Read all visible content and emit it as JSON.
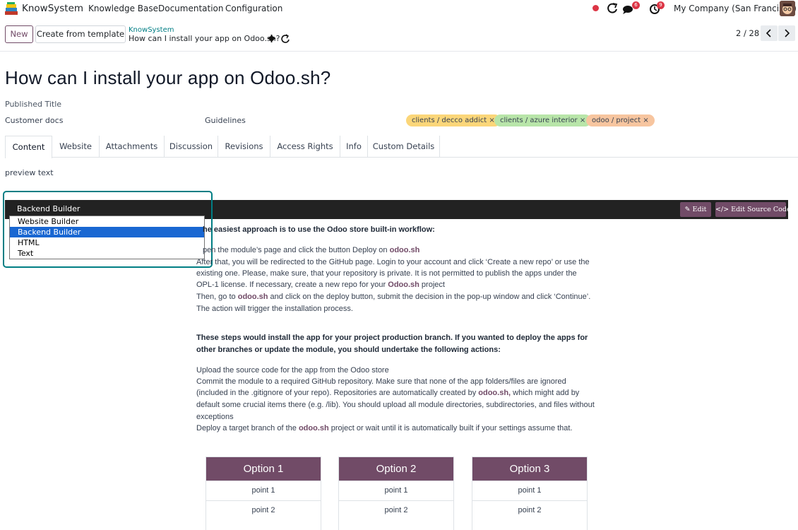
{
  "nav": {
    "app_name": "KnowSystem",
    "menu": [
      "Knowledge Base",
      "Documentation",
      "Configuration"
    ],
    "messages_count": "6",
    "activities_count": "9",
    "company": "My Company (San Francisco)"
  },
  "control": {
    "new_label": "New",
    "template_label": "Create from template",
    "breadcrumb_parent": "KnowSystem",
    "breadcrumb_current": "How can I install your app on Odoo.sh?",
    "pager": "2 / 28"
  },
  "form": {
    "title": "How can I install your app on Odoo.sh?",
    "published_title_label": "Published Title",
    "section": "Customer docs",
    "type": "Guidelines",
    "tags": [
      {
        "label": "clients / decco addict ×",
        "color": "#fbd679"
      },
      {
        "label": "clients / azure interior ×",
        "color": "#b8e5a9"
      },
      {
        "label": "odoo / project ×",
        "color": "#f7c59f"
      }
    ]
  },
  "tabs": [
    "Content",
    "Website",
    "Attachments",
    "Discussion",
    "Revisions",
    "Access Rights",
    "Info",
    "Custom Details"
  ],
  "editor": {
    "preview_label": "preview text",
    "edit_label": "Edit",
    "edit_source_label": "Edit Source Code",
    "builder_selected": "Backend Builder",
    "builder_options": [
      "Website Builder",
      "Backend Builder",
      "HTML",
      "Text"
    ]
  },
  "article": {
    "intro": "he easiest approach is to use the Odoo store built-in workflow:",
    "line1_pre": "pen the module’s page and click the button Deploy on ",
    "line1_link": "odoo.sh",
    "line2": "After that, you will be redirected to the GitHub page. Login to your account and click ‘Create a new repo’ or use the",
    "line3": "existing one. Please, make sure, that your repository is private. It is not permitted to publish the apps under the",
    "line4_pre": "OPL-1 license. If necessary, create a new repo for your ",
    "line4_link": "Odoo.sh",
    "line4_post": " project",
    "line5_pre": "Then, go to ",
    "line5_link": "odoo.sh",
    "line5_post": " and click on the deploy button, submit the decision in the pop-up window and click ‘Continue’.",
    "line6": "The action will trigger the installation process.",
    "heading2_line1": "These steps would install the app for your project production branch. If you wanted to deploy the apps for",
    "heading2_line2": "other branches or update the module, you should undertake the following actions:",
    "p1": "Upload the source code for the app from the Odoo store",
    "p2": "Commit the module to a required GitHub repository. Make sure that none of the app folders/files are ignored",
    "p3_pre": "(included in the .gitignore of your repo). Repositories are automatically created by ",
    "p3_link": "odoo.sh,",
    "p3_post": " which might add by",
    "p4": "default some crucial items there (e.g. /lib). You should upload all module directories, subdirectories, and files without",
    "p5": "exceptions",
    "p6_pre": "Deploy a target branch of the ",
    "p6_link": "odoo.sh",
    "p6_post": " project or wait until it is automatically built if your settings assume that.",
    "options": [
      {
        "title": "Option 1",
        "points": [
          "point 1",
          "point 2"
        ]
      },
      {
        "title": "Option 2",
        "points": [
          "point 1",
          "point 2"
        ]
      },
      {
        "title": "Option 3",
        "points": [
          "point 1",
          "point 2"
        ]
      }
    ]
  }
}
